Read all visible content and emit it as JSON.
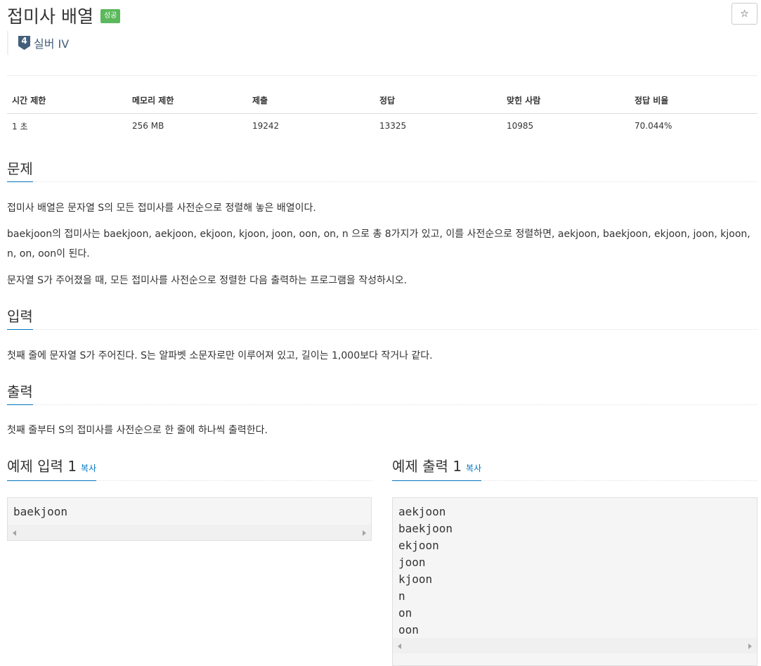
{
  "problem": {
    "title": "접미사 배열",
    "status_badge": "성공",
    "star_icon": "☆",
    "tier_number": "4",
    "tier_label": "실버 IV"
  },
  "info_table": {
    "headers": [
      "시간 제한",
      "메모리 제한",
      "제출",
      "정답",
      "맞힌 사람",
      "정답 비율"
    ],
    "values": [
      "1 초",
      "256 MB",
      "19242",
      "13325",
      "10985",
      "70.044%"
    ]
  },
  "sections": {
    "description_title": "문제",
    "description_p1": "접미사 배열은 문자열 S의 모든 접미사를 사전순으로 정렬해 놓은 배열이다.",
    "description_p2": "baekjoon의 접미사는 baekjoon, aekjoon, ekjoon, kjoon, joon, oon, on, n 으로 총 8가지가 있고, 이를 사전순으로 정렬하면, aekjoon, baekjoon, ekjoon, joon, kjoon, n, on, oon이 된다.",
    "description_p3": "문자열 S가 주어졌을 때, 모든 접미사를 사전순으로 정렬한 다음 출력하는 프로그램을 작성하시오.",
    "input_title": "입력",
    "input_p": "첫째 줄에 문자열 S가 주어진다. S는 알파벳 소문자로만 이루어져 있고, 길이는 1,000보다 작거나 같다.",
    "output_title": "출력",
    "output_p": "첫째 줄부터 S의 접미사를 사전순으로 한 줄에 하나씩 출력한다."
  },
  "samples": {
    "input_title": "예제 입력 1",
    "output_title": "예제 출력 1",
    "copy_label": "복사",
    "input_lines": [
      "baekjoon"
    ],
    "output_lines": [
      "aekjoon",
      "baekjoon",
      "ekjoon",
      "joon",
      "kjoon",
      "n",
      "on",
      "oon"
    ]
  },
  "colors": {
    "accent": "#0076c0",
    "success": "#5cb85c",
    "tier": "#435f7a"
  }
}
